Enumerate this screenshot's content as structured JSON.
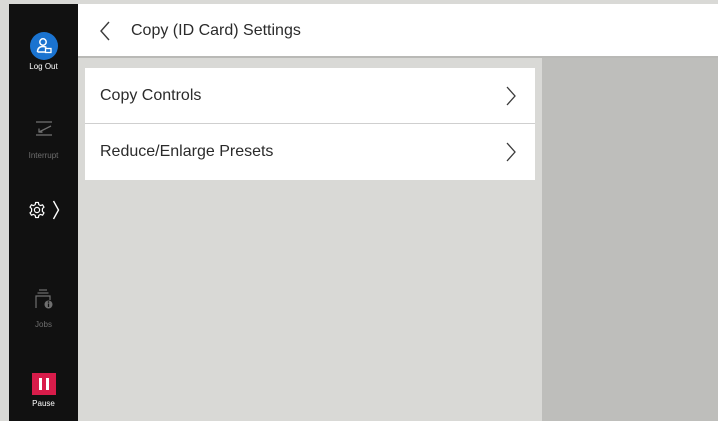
{
  "header": {
    "title": "Copy (ID Card) Settings",
    "back_icon": "chevron-left-icon"
  },
  "sidebar": {
    "logout": {
      "label": "Log Out",
      "icon": "user-logout-icon",
      "color": "#1a73d0"
    },
    "interrupt": {
      "label": "Interrupt",
      "icon": "interrupt-icon",
      "enabled": false
    },
    "settings": {
      "icon": "gear-icon",
      "expand_icon": "chevron-right-icon"
    },
    "jobs": {
      "label": "Jobs",
      "icon": "jobs-icon",
      "enabled": false
    },
    "pause": {
      "label": "Pause",
      "icon": "pause-icon",
      "color": "#d81c4a"
    }
  },
  "list": {
    "items": [
      {
        "label": "Copy Controls",
        "icon": "chevron-right-icon"
      },
      {
        "label": "Reduce/Enlarge Presets",
        "icon": "chevron-right-icon"
      }
    ]
  },
  "colors": {
    "sidebar_bg": "#111111",
    "content_bg": "#d9d9d6",
    "right_panel_bg": "#bebebb",
    "header_bg": "#ffffff"
  }
}
